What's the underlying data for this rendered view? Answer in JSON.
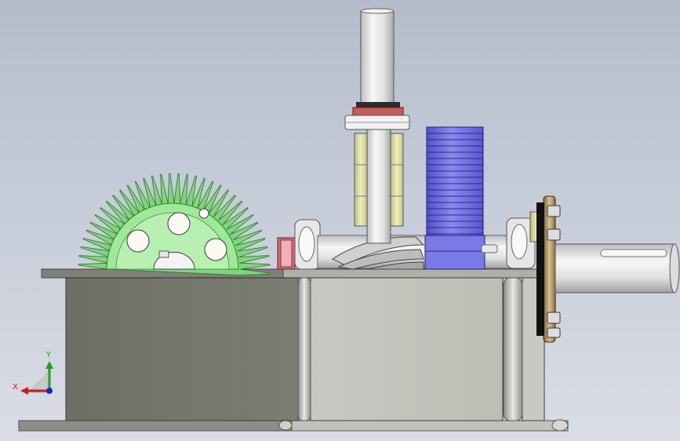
{
  "view": {
    "model_parts": [
      "gearbox-housing",
      "base-plate",
      "bevel-gear",
      "vertical-input-shaft",
      "worm-screw",
      "spur-gear",
      "output-shaft",
      "flange-bearing"
    ]
  },
  "triad": {
    "y_label": "Y",
    "x_label": "X",
    "y_color": "#1fa01f",
    "x_color": "#d0181c",
    "z_color": "#2020c0"
  },
  "colors": {
    "background_top": "#b4bccc",
    "background_bottom": "#dadde6",
    "housing_dark": "#75776c",
    "housing_light": "#c7c7c1",
    "bevel_gear": "#8fe08a",
    "spur_gear": "#6e6ee6",
    "shaft": "#e4e4e4",
    "bearing": "#d7d79a",
    "flange": "#b8a070"
  }
}
